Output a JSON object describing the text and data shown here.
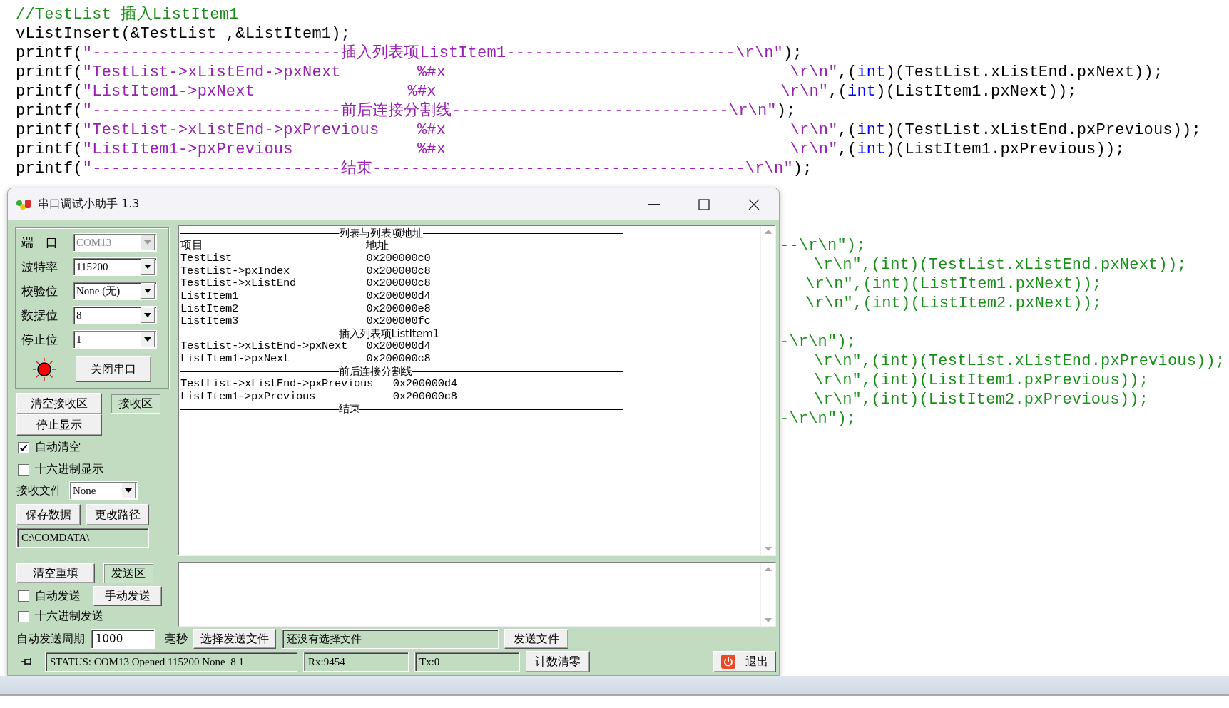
{
  "editor": {
    "lines": [
      {
        "segments": [
          {
            "kind": "comment",
            "text": "//TestList 插入ListItem1"
          }
        ]
      },
      {
        "segments": [
          {
            "kind": "plain",
            "text": "vListInsert(&TestList ,&ListItem1);"
          }
        ]
      },
      {
        "segments": [
          {
            "kind": "plain",
            "text": "printf("
          },
          {
            "kind": "string",
            "text": "\"--------------------------插入列表项ListItem1------------------------\\r\\n\""
          },
          {
            "kind": "plain",
            "text": ");"
          }
        ]
      },
      {
        "segments": [
          {
            "kind": "plain",
            "text": "printf("
          },
          {
            "kind": "string",
            "text": "\"TestList->xListEnd->pxNext        %#x                                    \\r\\n\""
          },
          {
            "kind": "plain",
            "text": ",("
          },
          {
            "kind": "keyword",
            "text": "int"
          },
          {
            "kind": "plain",
            "text": ")(TestList.xListEnd.pxNext));"
          }
        ]
      },
      {
        "segments": [
          {
            "kind": "plain",
            "text": "printf("
          },
          {
            "kind": "string",
            "text": "\"ListItem1->pxNext                %#x                                    \\r\\n\""
          },
          {
            "kind": "plain",
            "text": ",("
          },
          {
            "kind": "keyword",
            "text": "int"
          },
          {
            "kind": "plain",
            "text": ")(ListItem1.pxNext));"
          }
        ]
      },
      {
        "segments": [
          {
            "kind": "plain",
            "text": "printf("
          },
          {
            "kind": "string",
            "text": "\"--------------------------前后连接分割线-----------------------------\\r\\n\""
          },
          {
            "kind": "plain",
            "text": ");"
          }
        ]
      },
      {
        "segments": [
          {
            "kind": "plain",
            "text": "printf("
          },
          {
            "kind": "string",
            "text": "\"TestList->xListEnd->pxPrevious    %#x                                    \\r\\n\""
          },
          {
            "kind": "plain",
            "text": ",("
          },
          {
            "kind": "keyword",
            "text": "int"
          },
          {
            "kind": "plain",
            "text": ")(TestList.xListEnd.pxPrevious));"
          }
        ]
      },
      {
        "segments": [
          {
            "kind": "plain",
            "text": "printf("
          },
          {
            "kind": "string",
            "text": "\"ListItem1->pxPrevious             %#x                                    \\r\\n\""
          },
          {
            "kind": "plain",
            "text": ",("
          },
          {
            "kind": "keyword",
            "text": "int"
          },
          {
            "kind": "plain",
            "text": ")(ListItem1.pxPrevious));"
          }
        ]
      },
      {
        "segments": [
          {
            "kind": "plain",
            "text": "printf("
          },
          {
            "kind": "string",
            "text": "\"--------------------------结束---------------------------------------\\r\\n\""
          },
          {
            "kind": "plain",
            "text": ");"
          }
        ]
      }
    ],
    "tail_lines": [
      {
        "kind": "dash",
        "text": "--\\r\\n\");"
      },
      {
        "kind": "arg",
        "text": "\\r\\n\",(int)(TestList.xListEnd.pxNext));"
      },
      {
        "kind": "arg_narrow",
        "text": "\\r\\n\",(int)(ListItem1.pxNext));"
      },
      {
        "kind": "arg_narrow",
        "text": "\\r\\n\",(int)(ListItem2.pxNext));"
      },
      {
        "kind": "blank"
      },
      {
        "kind": "dash",
        "text": "-\\r\\n\");"
      },
      {
        "kind": "arg",
        "text": "\\r\\n\",(int)(TestList.xListEnd.pxPrevious));"
      },
      {
        "kind": "arg",
        "text": "\\r\\n\",(int)(ListItem1.pxPrevious));"
      },
      {
        "kind": "arg",
        "text": "\\r\\n\",(int)(ListItem2.pxPrevious));"
      },
      {
        "kind": "dash",
        "text": "-\\r\\n\");"
      }
    ]
  },
  "dialog": {
    "title": "串口调试小助手 1.3",
    "port_settings": [
      {
        "label": "端　口",
        "value": "COM13",
        "disabled": true
      },
      {
        "label": "波特率",
        "value": "115200",
        "disabled": false
      },
      {
        "label": "校验位",
        "value": "None (无)",
        "disabled": false
      },
      {
        "label": "数据位",
        "value": "8",
        "disabled": false
      },
      {
        "label": "停止位",
        "value": "1",
        "disabled": false
      }
    ],
    "led": {
      "on": true
    },
    "port_button": "关闭串口",
    "receive_controls": {
      "clear_button": "清空接收区",
      "area_label": "接收区",
      "stop_button": "停止显示",
      "checkboxes": [
        {
          "label": "自动清空",
          "checked": true
        },
        {
          "label": "十六进制显示",
          "checked": false
        }
      ],
      "file_label": "接收文件",
      "file_value": "None",
      "save_button": "保存数据",
      "path_button": "更改路径",
      "path": "C:\\COMDATA\\"
    },
    "receive_lines": [
      {
        "kind": "rule",
        "title": "列表与列表项地址"
      },
      {
        "kind": "row",
        "item": "项目",
        "address": "地址"
      },
      {
        "kind": "row",
        "item": "TestList",
        "address": "0x200000c0"
      },
      {
        "kind": "row",
        "item": "TestList->pxIndex",
        "address": "0x200000c8"
      },
      {
        "kind": "row",
        "item": "TestList->xListEnd",
        "address": "0x200000c8"
      },
      {
        "kind": "row",
        "item": "ListItem1",
        "address": "0x200000d4"
      },
      {
        "kind": "row",
        "item": "ListItem2",
        "address": "0x200000e8"
      },
      {
        "kind": "row",
        "item": "ListItem3",
        "address": "0x200000fc"
      },
      {
        "kind": "rule",
        "title": "插入列表项ListItem1"
      },
      {
        "kind": "row",
        "item": "TestList->xListEnd->pxNext",
        "address": "0x200000d4"
      },
      {
        "kind": "row",
        "item": "ListItem1->pxNext",
        "address": "0x200000c8"
      },
      {
        "kind": "rule",
        "title": "前后连接分割线"
      },
      {
        "kind": "row",
        "item": "TestList->xListEnd->pxPrevious",
        "address": "0x200000d4"
      },
      {
        "kind": "row",
        "item": "ListItem1->pxPrevious",
        "address": "0x200000c8"
      },
      {
        "kind": "rule",
        "title": "结束"
      }
    ],
    "send_controls": {
      "clear_button": "清空重填",
      "area_label": "发送区",
      "auto_send": {
        "label": "自动发送",
        "checked": false
      },
      "manual_button": "手动发送",
      "hex_send": {
        "label": "十六进制发送",
        "checked": false
      }
    },
    "period": {
      "label": "自动发送周期",
      "value": "1000",
      "unit": "毫秒",
      "choose_button": "选择发送文件",
      "file_field": "还没有选择文件",
      "send_file_button": "发送文件"
    },
    "status": {
      "text": "STATUS: COM13 Opened 115200 None  8 1",
      "rx": "Rx:9454",
      "tx": "Tx:0",
      "reset_button": "计数清零",
      "exit_button": "退出"
    }
  }
}
